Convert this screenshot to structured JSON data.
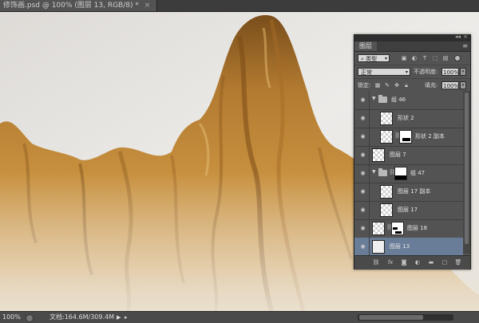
{
  "document": {
    "tab_title": "修饰画.psd @ 100% (图层 13, RGB/8) *",
    "close": "×"
  },
  "status_bar": {
    "zoom": "100%",
    "doc_info": "文档:164.6M/309.4M",
    "play_icon": "play-icon"
  },
  "layers_panel": {
    "title": "图层",
    "collapse_glyph": "◂◂",
    "close_glyph": "×",
    "menu_glyph": "≡",
    "filter_kind": "类型",
    "blend_mode": "正常",
    "opacity_label": "不透明度:",
    "opacity_value": "100%",
    "lock_label": "锁定:",
    "fill_label": "填充:",
    "fill_value": "100%",
    "layers": [
      {
        "name": "组 46",
        "type": "group",
        "expanded": true
      },
      {
        "name": "形状 2",
        "type": "layer",
        "indent": true
      },
      {
        "name": "形状 2 副本",
        "type": "masked",
        "indent": true
      },
      {
        "name": "图层 7",
        "type": "layer"
      },
      {
        "name": "组 47",
        "type": "group-mask",
        "expanded": true
      },
      {
        "name": "图层 17 副本",
        "type": "layer",
        "indent": true
      },
      {
        "name": "图层 17",
        "type": "layer",
        "indent": true
      },
      {
        "name": "图层 18",
        "type": "masked"
      },
      {
        "name": "图层 13",
        "type": "layer",
        "selected": true
      }
    ],
    "footer_icons": [
      "link-icon",
      "fx-icon",
      "add-mask-icon",
      "adjustment-icon",
      "new-group-icon",
      "new-layer-icon",
      "trash-icon"
    ]
  },
  "colors": {
    "selection": "#6a7d98",
    "rock_light": "#c8913f",
    "rock_dark": "#6e4615",
    "background": "#e7e5e2"
  }
}
